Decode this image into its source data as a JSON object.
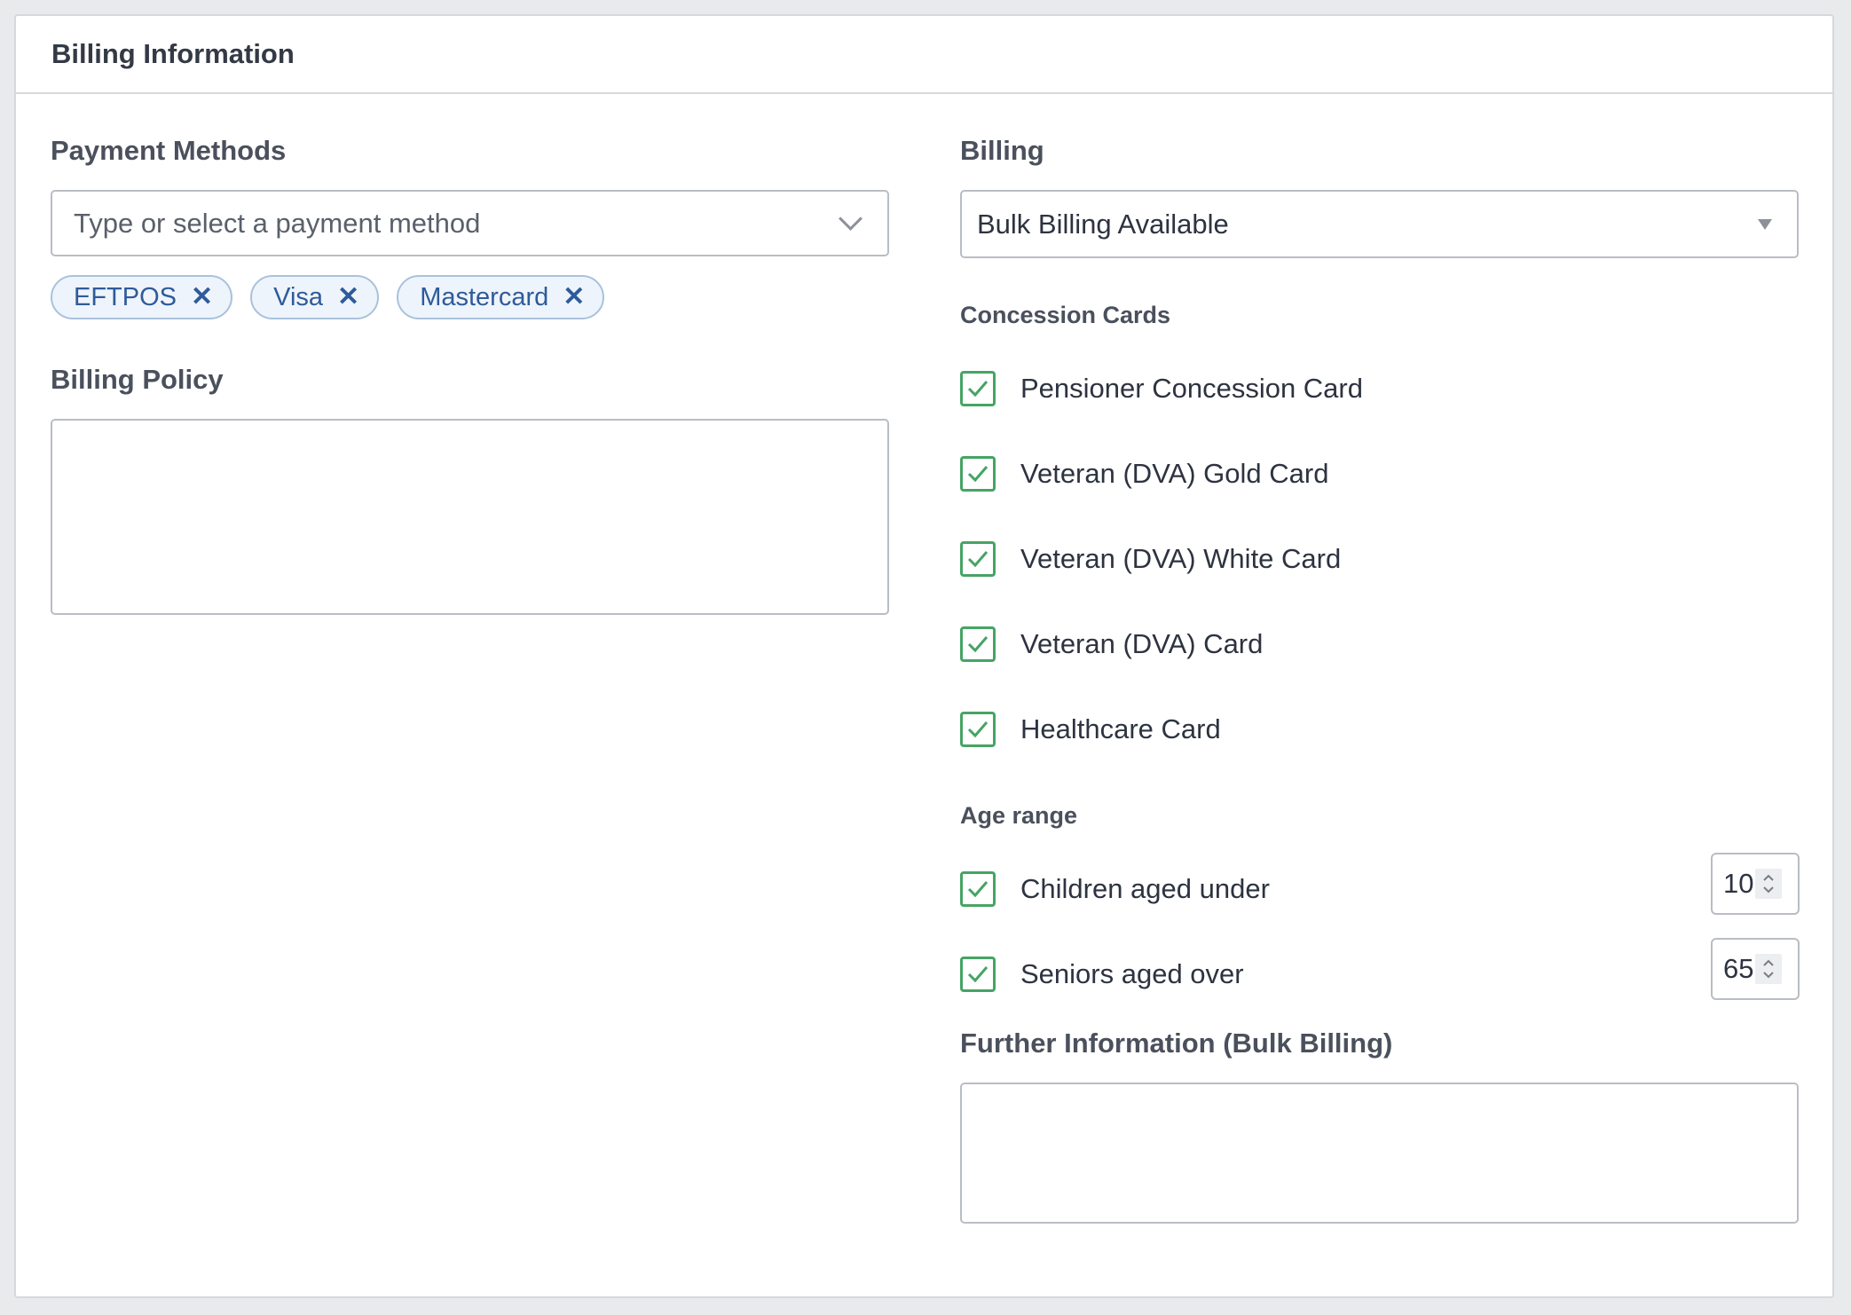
{
  "panel": {
    "title": "Billing Information"
  },
  "payment_methods": {
    "label": "Payment Methods",
    "placeholder": "Type or select a payment method",
    "tags": [
      "EFTPOS",
      "Visa",
      "Mastercard"
    ]
  },
  "billing_policy": {
    "label": "Billing Policy",
    "value": ""
  },
  "billing": {
    "label": "Billing",
    "selected": "Bulk Billing Available"
  },
  "concession_cards": {
    "label": "Concession Cards",
    "items": [
      {
        "label": "Pensioner Concession Card",
        "checked": true
      },
      {
        "label": "Veteran (DVA) Gold Card",
        "checked": true
      },
      {
        "label": "Veteran (DVA) White Card",
        "checked": true
      },
      {
        "label": "Veteran (DVA) Card",
        "checked": true
      },
      {
        "label": "Healthcare Card",
        "checked": true
      }
    ]
  },
  "age_range": {
    "label": "Age range",
    "children": {
      "label": "Children aged under",
      "checked": true,
      "value": "10"
    },
    "seniors": {
      "label": "Seniors aged over",
      "checked": true,
      "value": "65"
    }
  },
  "further_information": {
    "label": "Further Information (Bulk Billing)",
    "value": ""
  },
  "colors": {
    "checkbox_border": "#46a464",
    "tag_text": "#2e5b9a",
    "tag_bg": "#eef4fb"
  }
}
